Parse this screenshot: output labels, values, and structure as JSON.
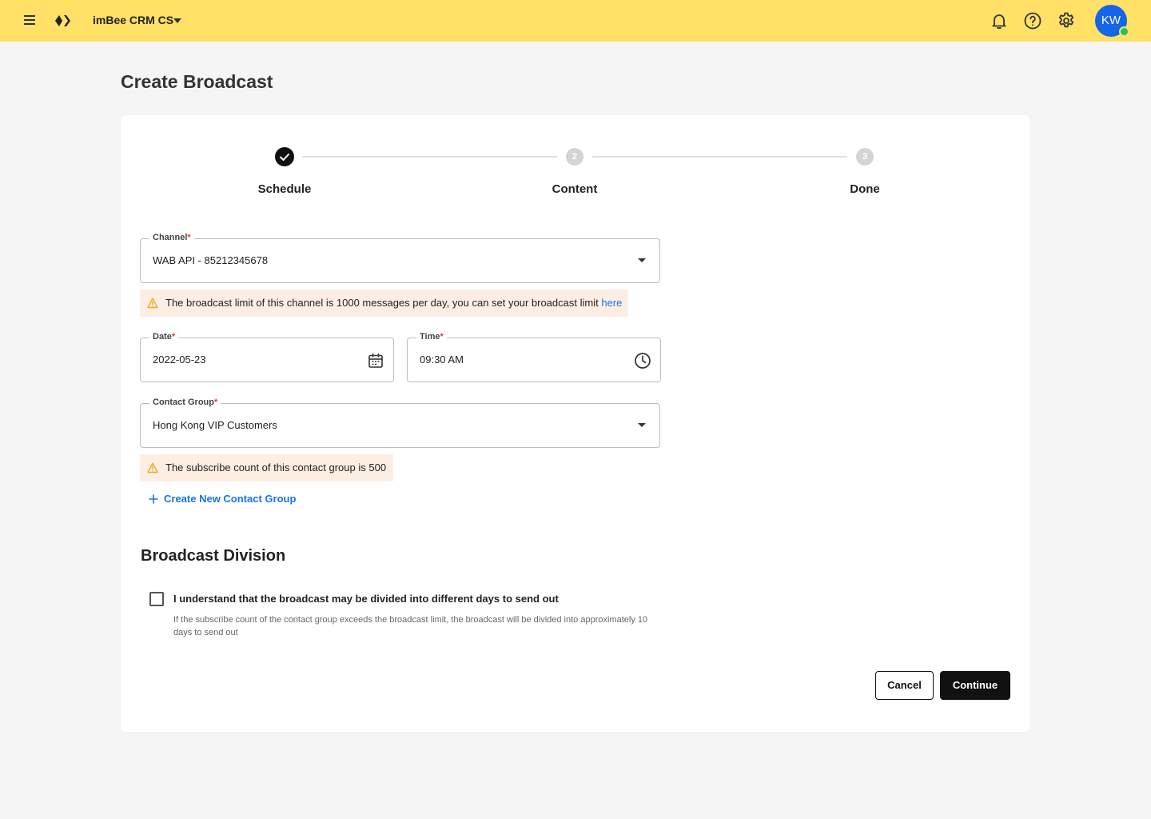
{
  "header": {
    "workspace": "imBee CRM CS",
    "avatar_initials": "KW",
    "icons": [
      "menu-icon",
      "logo-icon",
      "chevron-down-icon",
      "bell-icon",
      "help-icon",
      "gear-icon"
    ],
    "bg_color": "#ffe168",
    "avatar_color": "#1565e8",
    "online_color": "#1cc55a"
  },
  "page": {
    "title": "Create Broadcast"
  },
  "stepper": {
    "steps": [
      {
        "label": "Schedule",
        "number": "1",
        "state": "completed"
      },
      {
        "label": "Content",
        "number": "2",
        "state": "pending"
      },
      {
        "label": "Done",
        "number": "3",
        "state": "pending"
      }
    ]
  },
  "form": {
    "channel": {
      "label": "Channel",
      "required_mark": "*",
      "value": "WAB API - 85212345678"
    },
    "channel_warning": {
      "text": "The broadcast limit of this channel is 1000 messages per day, you can set your broadcast limit ",
      "link": "here"
    },
    "date": {
      "label": "Date",
      "required_mark": "*",
      "value": "2022-05-23",
      "icon": "calendar-icon"
    },
    "time": {
      "label": "Time",
      "required_mark": "*",
      "value": "09:30 AM",
      "icon": "clock-icon"
    },
    "contact_group": {
      "label": "Contact Group",
      "required_mark": "*",
      "value": "Hong Kong VIP Customers"
    },
    "group_warning": {
      "text": "The subscribe count of this contact group is 500"
    },
    "create_group_link": "Create New Contact Group"
  },
  "division": {
    "title": "Broadcast Division",
    "checkbox_label": "I understand that the broadcast may be divided into different days to send out",
    "checked": false,
    "help_text": "If the subscribe count of the contact group exceeds the broadcast limit, the broadcast will be divided into approximately 10 days to send out"
  },
  "actions": {
    "cancel": "Cancel",
    "continue": "Continue"
  },
  "colors": {
    "warning_bg": "#fdeee4",
    "warning_icon": "#f5a623",
    "link": "#1a73e8",
    "primary_button": "#111111"
  }
}
